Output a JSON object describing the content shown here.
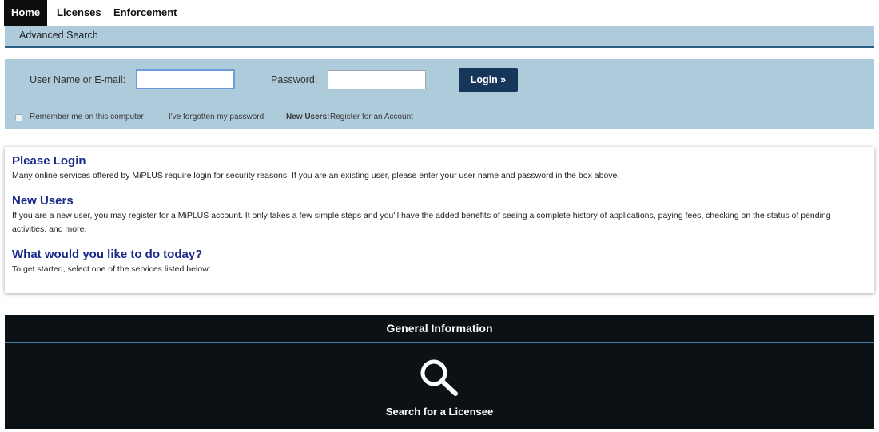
{
  "nav": {
    "tabs": [
      "Home",
      "Licenses",
      "Enforcement"
    ],
    "sub": "Advanced Search"
  },
  "login": {
    "username_label": "User Name or E-mail:",
    "password_label": "Password:",
    "username_value": "",
    "password_value": "",
    "button": "Login »",
    "remember": "Remember me on this computer",
    "forgot": "I've forgotten my password",
    "new_users_prefix": "New Users:",
    "register": "Register for an Account"
  },
  "info": {
    "login_heading": "Please Login",
    "login_text": "Many online services offered by MiPLUS require login for security reasons. If you are an existing user, please enter your user name and password in the box above.",
    "new_heading": "New Users",
    "new_text": "If you are a new user, you may register for a MiPLUS account. It only takes a few simple steps and you'll have the added benefits of seeing a complete history of applications, paying fees, checking on the status of pending activities, and more.",
    "todo_heading": "What would you like to do today?",
    "todo_text": "To get started, select one of the services listed below:"
  },
  "general": {
    "title": "General Information",
    "search_label": "Search for a Licensee",
    "icon": "search-icon"
  },
  "colors": {
    "panel": "#aecbdc",
    "button": "#16365a",
    "heading": "#1a2a8a",
    "dark": "#0c1116"
  }
}
